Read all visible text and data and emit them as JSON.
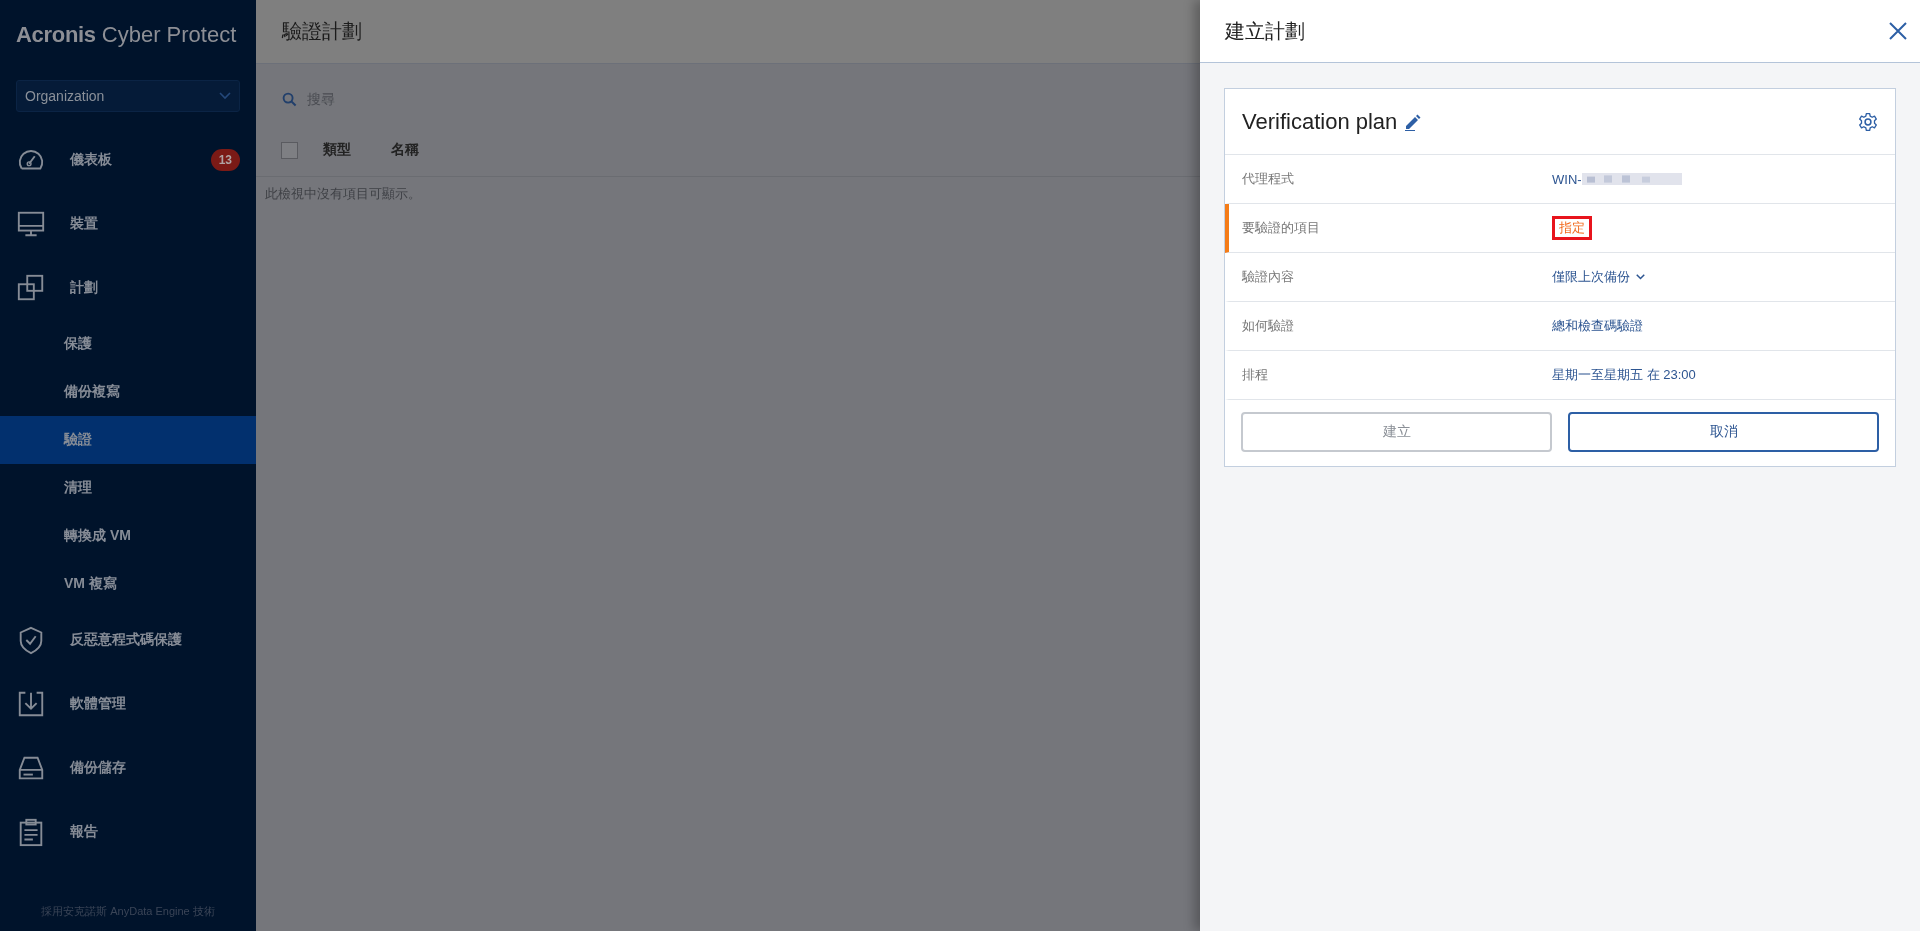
{
  "logo": {
    "brand": "Acronis",
    "product": "Cyber Protect"
  },
  "sidebar": {
    "org_selector": "Organization",
    "items": [
      {
        "label": "儀表板",
        "kind": "dashboard",
        "badge": "13",
        "selected": false
      },
      {
        "label": "裝置",
        "kind": "monitor",
        "selected": false
      },
      {
        "label": "計劃",
        "kind": "plans",
        "selected": false,
        "children": [
          {
            "label": "保護",
            "selected": false
          },
          {
            "label": "備份複寫",
            "selected": false
          },
          {
            "label": "驗證",
            "selected": true
          },
          {
            "label": "清理",
            "selected": false
          },
          {
            "label": "轉換成 VM",
            "selected": false
          },
          {
            "label": "VM 複寫",
            "selected": false
          }
        ]
      },
      {
        "label": "反惡意程式碼保護",
        "kind": "shield",
        "selected": false
      },
      {
        "label": "軟體管理",
        "kind": "download",
        "selected": false
      },
      {
        "label": "備份儲存",
        "kind": "drive",
        "selected": false
      },
      {
        "label": "報告",
        "kind": "clipboard",
        "selected": false
      }
    ],
    "footer": "採用安克諾斯 AnyData Engine 技術"
  },
  "main": {
    "title": "驗證計劃",
    "search": {
      "placeholder": "搜尋"
    },
    "table": {
      "select_all_checked": false,
      "columns": [
        "類型",
        "名稱"
      ],
      "empty_message": "此檢視中沒有項目可顯示。"
    }
  },
  "panel": {
    "title": "建立計劃",
    "plan_name": "Verification plan",
    "rows": [
      {
        "label": "代理程式",
        "value": "WIN-",
        "kind": "redacted",
        "required": false
      },
      {
        "label": "要驗證的項目",
        "value": "指定",
        "kind": "highlighted",
        "required": true
      },
      {
        "label": "驗證內容",
        "value": "僅限上次備份",
        "kind": "dropdown",
        "required": false
      },
      {
        "label": "如何驗證",
        "value": "總和檢查碼驗證",
        "kind": "link",
        "required": false
      },
      {
        "label": "排程",
        "value": "星期一至星期五 在 23:00",
        "kind": "link",
        "required": false
      }
    ],
    "buttons": [
      {
        "label": "建立",
        "disabled": true
      },
      {
        "label": "取消",
        "disabled": false
      }
    ]
  }
}
